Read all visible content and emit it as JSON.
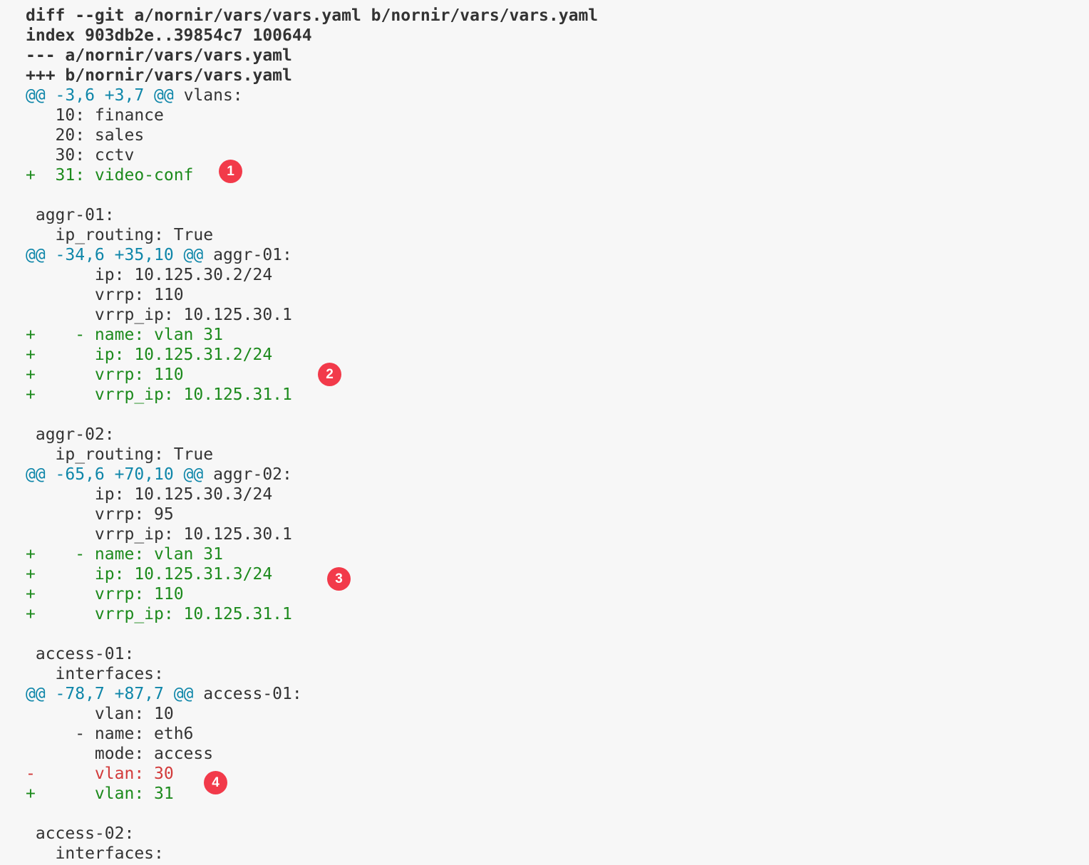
{
  "diff": {
    "header": [
      "diff --git a/nornir/vars/vars.yaml b/nornir/vars/vars.yaml",
      "index 903db2e..39854c7 100644",
      "--- a/nornir/vars/vars.yaml",
      "+++ b/nornir/vars/vars.yaml"
    ],
    "hunk1": {
      "range": "@@ -3,6 +3,7 @@",
      "context": " vlans:",
      "lines": [
        "   10: finance",
        "   20: sales",
        "   30: cctv"
      ],
      "added": [
        "+  31: video-conf"
      ]
    },
    "block1": [
      "",
      " aggr-01:",
      "   ip_routing: True"
    ],
    "hunk2": {
      "range": "@@ -34,6 +35,10 @@",
      "context": " aggr-01:",
      "lines": [
        "       ip: 10.125.30.2/24",
        "       vrrp: 110",
        "       vrrp_ip: 10.125.30.1"
      ],
      "added": [
        "+    - name: vlan 31",
        "+      ip: 10.125.31.2/24",
        "+      vrrp: 110",
        "+      vrrp_ip: 10.125.31.1"
      ]
    },
    "block2": [
      "",
      " aggr-02:",
      "   ip_routing: True"
    ],
    "hunk3": {
      "range": "@@ -65,6 +70,10 @@",
      "context": " aggr-02:",
      "lines": [
        "       ip: 10.125.30.3/24",
        "       vrrp: 95",
        "       vrrp_ip: 10.125.30.1"
      ],
      "added": [
        "+    - name: vlan 31",
        "+      ip: 10.125.31.3/24",
        "+      vrrp: 110",
        "+      vrrp_ip: 10.125.31.1"
      ]
    },
    "block3": [
      "",
      " access-01:",
      "   interfaces:"
    ],
    "hunk4": {
      "range": "@@ -78,7 +87,7 @@",
      "context": " access-01:",
      "lines": [
        "       vlan: 10",
        "     - name: eth6",
        "       mode: access"
      ],
      "removed": [
        "-      vlan: 30"
      ],
      "added": [
        "+      vlan: 31"
      ]
    },
    "block4": [
      "",
      " access-02:",
      "   interfaces:"
    ]
  },
  "badges": [
    "1",
    "2",
    "3",
    "4"
  ],
  "colors": {
    "background": "#f7f7f7",
    "text": "#333333",
    "hunk_header": "#0e86a9",
    "added": "#1c8a1c",
    "removed": "#d23a3a",
    "badge": "#f23a4a"
  }
}
